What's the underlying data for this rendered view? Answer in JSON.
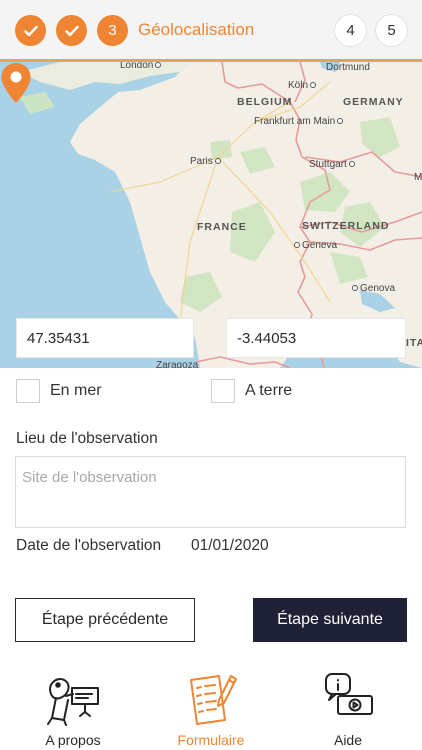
{
  "stepper": {
    "steps": [
      {
        "label": "",
        "state": "done"
      },
      {
        "label": "",
        "state": "done"
      },
      {
        "label": "3",
        "state": "current"
      },
      {
        "label": "4",
        "state": "todo"
      },
      {
        "label": "5",
        "state": "todo"
      }
    ],
    "current_title": "Géolocalisation",
    "accent_color": "#ef8533"
  },
  "map": {
    "labels": {
      "london": "London",
      "dortmund": "Dortmund",
      "koln": "Köln",
      "belgium": "BELGIUM",
      "germany": "GERMANY",
      "frankfurt": "Frankfurt am Main",
      "paris": "Paris",
      "stuttgart": "Stuttgart",
      "france": "FRANCE",
      "switzerland": "SWITZERLAND",
      "geneva": "Geneva",
      "genova": "Genova",
      "zaragoza": "Zaragoza",
      "m": "M",
      "ita": "ITA"
    },
    "marker_icon": "location-pin-icon"
  },
  "coordinates": {
    "latitude": "47.35431",
    "longitude": "-3.44053"
  },
  "form": {
    "en_mer_label": "En mer",
    "a_terre_label": "A terre",
    "lieu_label": "Lieu de l'observation",
    "lieu_placeholder": "Site de l'observation",
    "date_label": "Date de l'observation",
    "date_value": "01/01/2020"
  },
  "buttons": {
    "prev": "Étape précédente",
    "next": "Étape suivante"
  },
  "tabbar": {
    "items": [
      {
        "label": "A propos",
        "icon": "fish-presenter-icon",
        "active": false
      },
      {
        "label": "Formulaire",
        "icon": "form-pencil-icon",
        "active": true
      },
      {
        "label": "Aide",
        "icon": "help-video-icon",
        "active": false
      }
    ]
  }
}
